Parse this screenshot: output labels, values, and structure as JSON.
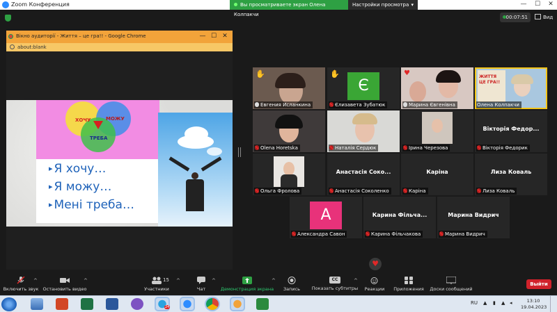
{
  "window": {
    "title": "Zoom Конференция",
    "share_banner": "Вы просматриваете экран Олена Колпакчи",
    "view_settings": "Настройки просмотра",
    "minimize": "—",
    "maximize": "☐",
    "close": "✕"
  },
  "meeting": {
    "timer": "00:07:51",
    "view_label": "Вид"
  },
  "shared_screen": {
    "browser_title": "Вікно аудиторії - Життя – це гра!! - Google Chrome",
    "address": "about:blank",
    "slide": {
      "venn_labels": [
        "ХОЧУ",
        "МОЖУ",
        "ТРЕБА"
      ],
      "bullets": [
        "Я хочу…",
        "Я можу…",
        "Мені треба…"
      ]
    }
  },
  "participants": [
    {
      "name": "Евгения Исланкина",
      "mic": "on",
      "badge": "hand",
      "kind": "video"
    },
    {
      "name": "Єлизавета Зубатюк",
      "mic": "off",
      "badge": "hand",
      "kind": "avatar",
      "avatar_letter": "Є",
      "avatar_color": "#3aa635"
    },
    {
      "name": "Марина Євгенівна",
      "mic": "on",
      "badge": "heart",
      "kind": "video"
    },
    {
      "name": "Олена Колпакчи",
      "mic": "none",
      "badge": "",
      "kind": "video",
      "speaking": true,
      "sign_text": "ЖИТТЯ ЦЕ ГРА!!"
    },
    {
      "name": "Olena Horetska",
      "mic": "off",
      "badge": "",
      "kind": "video"
    },
    {
      "name": "Наталія Сердюк",
      "mic": "off",
      "badge": "",
      "kind": "video"
    },
    {
      "name": "Ірина Черезова",
      "mic": "off",
      "badge": "",
      "kind": "video"
    },
    {
      "name": "Вікторія Федорик",
      "mic": "off",
      "badge": "",
      "kind": "name",
      "big_name": "Вікторія Федор..."
    },
    {
      "name": "Ольга Фролова",
      "mic": "off",
      "badge": "",
      "kind": "video"
    },
    {
      "name": "Анастасія Соколенко",
      "mic": "off",
      "badge": "",
      "kind": "name",
      "big_name": "Анастасія Соко..."
    },
    {
      "name": "Каріна",
      "mic": "off",
      "badge": "",
      "kind": "name",
      "big_name": "Каріна"
    },
    {
      "name": "Лиза Коваль",
      "mic": "off",
      "badge": "",
      "kind": "name",
      "big_name": "Лиза Коваль"
    },
    {
      "name": "Александра Савон",
      "mic": "off",
      "badge": "",
      "kind": "avatar",
      "avatar_letter": "А",
      "avatar_color": "#e8327a"
    },
    {
      "name": "Карина Фільчакова",
      "mic": "off",
      "badge": "",
      "kind": "name",
      "big_name": "Карина Фільча..."
    },
    {
      "name": "Марина Видрич",
      "mic": "off",
      "badge": "",
      "kind": "name",
      "big_name": "Марина Видрич"
    }
  ],
  "toolbar": {
    "unmute": "Включить звук",
    "stop_video": "Остановить видео",
    "participants": "Участники",
    "participants_count": "15",
    "chat": "Чат",
    "share": "Демонстрация экрана",
    "record": "Запись",
    "subtitles": "Показать субтитры",
    "cc_icon_text": "CC",
    "reactions": "Реакции",
    "apps": "Приложения",
    "whiteboards": "Доски сообщений",
    "leave": "Выйти"
  },
  "taskbar": {
    "language": "RU",
    "time": "13:10",
    "date": "19.04.2023",
    "yandex_badge": "24"
  }
}
